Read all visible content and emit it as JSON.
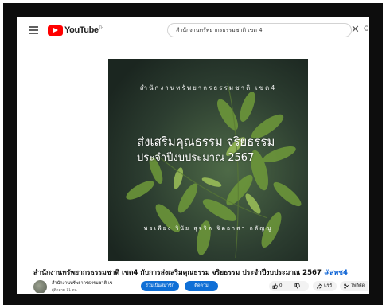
{
  "header": {
    "logo_text": "YouTube",
    "logo_sup": "TH",
    "search_value": "สำนักงานทรัพยากรธรรมชาติ เขต 4",
    "clear_symbol": "✕"
  },
  "video": {
    "line1": "สำนักงานทรัพยากรธรรมชาติ เขต4",
    "line2": "ส่งเสริมคุณธรรม จริยธรรม",
    "line3": "ประจำปีงบประมาณ 2567",
    "line4": "พอเพียง วินัย สุจริต จิตอาสา กตัญญู"
  },
  "details": {
    "title": "สำนักงานทรัพยากรธรรมชาติ เขต4 กับการส่งเสริมคุณธรรม จริยธรรม ประจำปีงบประมาณ 2567",
    "hashtag": "#สทช4",
    "channel_name": "สำนักงานทรัพยากรธรรมชาติ เข",
    "subscribers": "ผู้ติดตาม 11 คน",
    "join_label": "ร่วมเป็นสมาชิก",
    "subscribe_label": "ติดตาม",
    "like_count": "0",
    "share_label": "แชร์",
    "clip_label": "ไฟล์ตัด",
    "more_label": "···"
  },
  "colors": {
    "brand_red": "#ff0000",
    "button_blue": "#0f6fd6",
    "hashtag_blue": "#065fd4",
    "frame": "#0d0d0d"
  }
}
